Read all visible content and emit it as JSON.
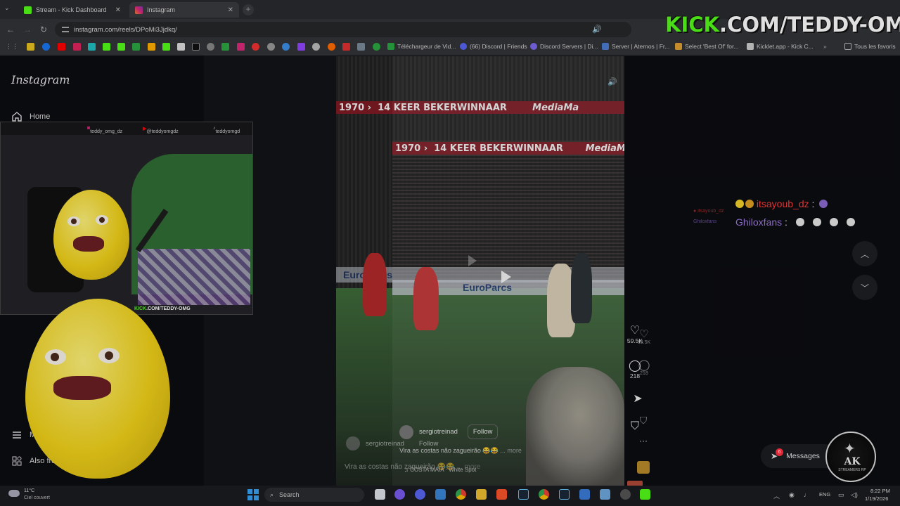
{
  "browser": {
    "tabs": [
      {
        "label": "Stream - Kick Dashboard",
        "favicon_color": "#53fc18"
      },
      {
        "label": "Instagram",
        "favicon_color": "#e1306c",
        "active": true
      }
    ],
    "new_tab_label": "+",
    "url": "instagram.com/reels/DPoMi3Jjdkq/",
    "bookmarks": [
      {
        "label": "Téléchargeur de Vid...",
        "color": "#2ba640"
      },
      {
        "label": "(66) Discord | Friends",
        "color": "#5865f2"
      },
      {
        "label": "Discord Servers | Di...",
        "color": "#7b68ee"
      },
      {
        "label": "Server | Aternos | Fr...",
        "color": "#4a7bd0"
      },
      {
        "label": "Select 'Best Of' for...",
        "color": "#e0a030"
      },
      {
        "label": "Kicklet.app - Kick C...",
        "color": "#cccccc"
      }
    ],
    "bookmarks_overflow": "»",
    "all_bookmarks": "Tous les favoris"
  },
  "kick_watermark": {
    "kick": "KICK",
    "rest": ".COM/TEDDY-OMG"
  },
  "instagram": {
    "logo": "Instagram",
    "nav": {
      "home": "Home",
      "more": "More",
      "meta": "Also from Meta"
    }
  },
  "facecam": {
    "instagram_handle": "teddy_omg_dz",
    "youtube_handle": "@teddyomgdz",
    "tiktok_handle": "teddyomgd",
    "kick_prefix": "KICK",
    "kick_rest": ".COM/TEDDY-OMG"
  },
  "reel": {
    "banner_year": "1970",
    "banner_text": "14 KEER BEKERWINNAAR",
    "banner_sponsor": "MediaMa",
    "board_text": "EuroParcs",
    "author": "sergiotreinad",
    "follow_label": "Follow",
    "caption": "Vira as costas não zagueirão 😂😂",
    "more_label": "... more",
    "audio": "COSTA MAIA · White Spot",
    "likes": "59.5K",
    "comments": "218"
  },
  "chat": [
    {
      "user": "itsayoub_dz",
      "sep": ":"
    },
    {
      "user": "Ghiloxfans",
      "sep": ":"
    }
  ],
  "messages": {
    "label": "Messages",
    "badge": "6"
  },
  "ak_badge": {
    "big": "AK",
    "small": "STREAMERS RP"
  },
  "taskbar": {
    "weather_temp": "11°C",
    "weather_desc": "Ciel couvert",
    "search_placeholder": "Search",
    "language": "ENG",
    "time": "8:22 PM",
    "date": "1/19/2026"
  }
}
